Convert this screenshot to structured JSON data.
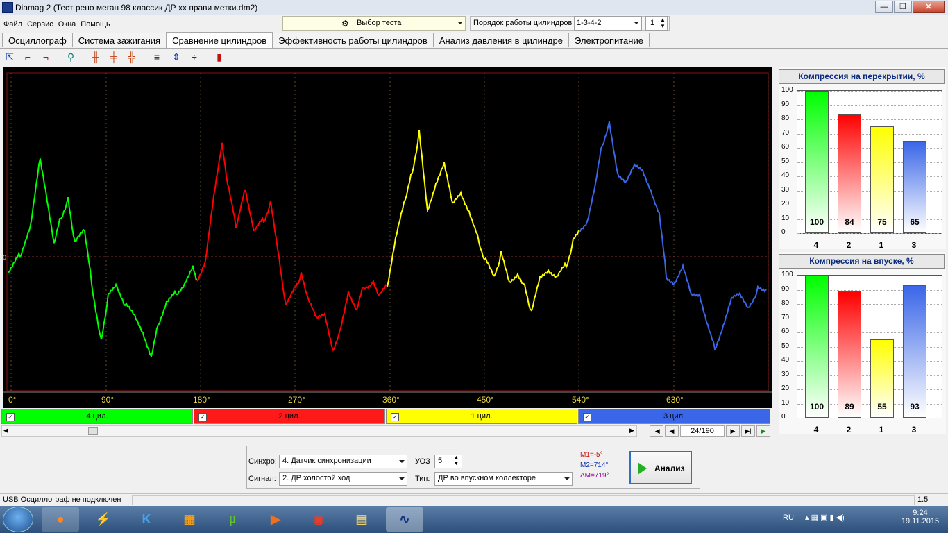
{
  "window": {
    "title": "Diamag 2 (Тест рено меган 98 классик ДР хх прави метки.dm2)",
    "min": "—",
    "max": "❐",
    "close": "✕"
  },
  "menu": [
    "Файл",
    "Сервис",
    "Окна",
    "Помощь"
  ],
  "toolbar": {
    "test_select": "Выбор теста",
    "order_label": "Порядок работы цилиндров",
    "order_value": "1-3-4-2",
    "cylinder_num": "1"
  },
  "tabs": [
    "Осциллограф",
    "Система зажигания",
    "Сравнение цилиндров",
    "Эффективность работы цилиндров",
    "Анализ давления в цилиндре",
    "Электропитание"
  ],
  "active_tab": 2,
  "scope": {
    "zero_label": "0",
    "degree_ticks": [
      "0°",
      "90°",
      "180°",
      "270°",
      "360°",
      "450°",
      "540°",
      "630°"
    ],
    "cylinders": [
      {
        "label": "4 цил.",
        "color": "#00ff00",
        "check": "✓"
      },
      {
        "label": "2 цил.",
        "color": "#ff0000",
        "check": "✓"
      },
      {
        "label": "1 цил.",
        "color": "#ffff00",
        "check": "✓"
      },
      {
        "label": "3 цил.",
        "color": "#3a66e8",
        "check": "✓"
      }
    ],
    "frame": "24/190"
  },
  "panels": [
    {
      "title": "Компрессия на перекрытии, %",
      "y_ticks": [
        "100",
        "90",
        "80",
        "70",
        "60",
        "50",
        "40",
        "30",
        "20",
        "10",
        "0"
      ],
      "bars": [
        {
          "label": "4",
          "value": 100,
          "color": "#00ff00"
        },
        {
          "label": "2",
          "value": 84,
          "color": "#ff0000"
        },
        {
          "label": "1",
          "value": 75,
          "color": "#ffff00"
        },
        {
          "label": "3",
          "value": 65,
          "color": "#3a66e8"
        }
      ]
    },
    {
      "title": "Компрессия на впуске, %",
      "y_ticks": [
        "100",
        "90",
        "80",
        "70",
        "60",
        "50",
        "40",
        "30",
        "20",
        "10",
        "0"
      ],
      "bars": [
        {
          "label": "4",
          "value": 100,
          "color": "#00ff00"
        },
        {
          "label": "2",
          "value": 89,
          "color": "#ff0000"
        },
        {
          "label": "1",
          "value": 55,
          "color": "#ffff00"
        },
        {
          "label": "3",
          "value": 93,
          "color": "#3a66e8"
        }
      ]
    }
  ],
  "bottom": {
    "sync_label": "Синхро:",
    "sync_value": "4.  Датчик синхронизации",
    "signal_label": "Сигнал:",
    "signal_value": "2.  ДР холостой ход",
    "uoz_label": "УОЗ",
    "uoz_value": "5",
    "type_label": "Тип:",
    "type_value": "ДР во впускном коллекторе",
    "m1": "M1=-5°",
    "m2": "M2=714°",
    "dm": "ΔM=719°",
    "analyze": "Анализ"
  },
  "status": {
    "text": "USB Осциллограф не подключен",
    "right": "1.5"
  },
  "taskbar": {
    "lang": "RU",
    "time": "9:24",
    "date": "19.11.2015"
  }
}
